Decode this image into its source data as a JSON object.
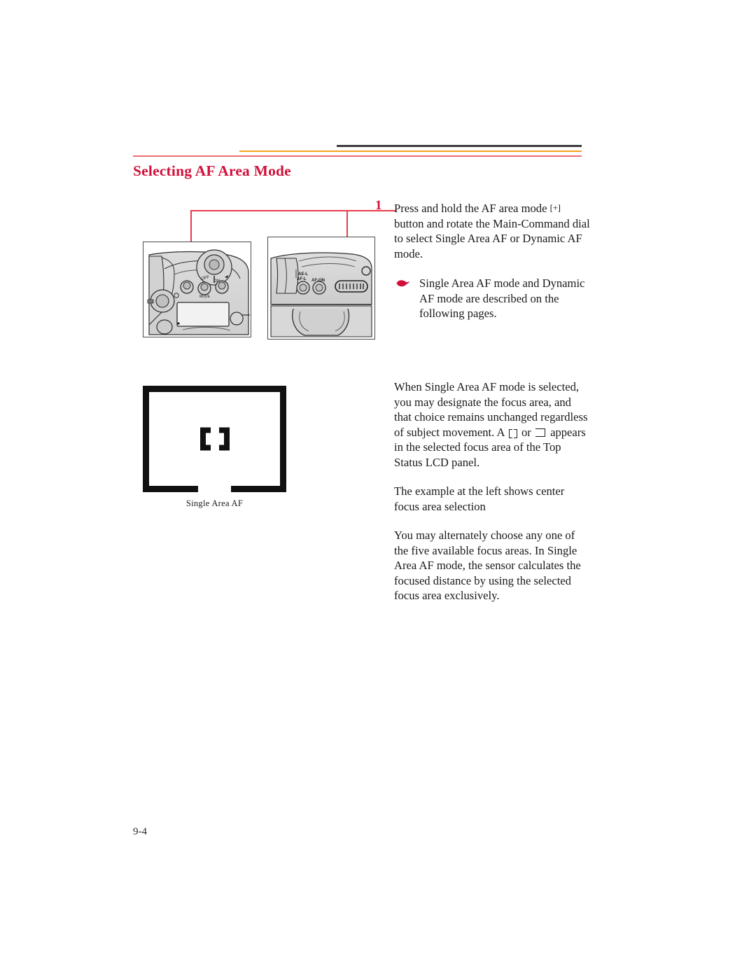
{
  "document": {
    "title": "Selecting AF Area Mode",
    "folio": "9-4"
  },
  "rules": {
    "dark_color": "#3a3a3a",
    "orange_color": "#f5a01e",
    "red_color": "#ea6d72"
  },
  "colors": {
    "title": "#d1103a",
    "step_number": "#d1103a",
    "leader_line": "#ea3b4a",
    "bullet": "#d1103a",
    "body_text": "#1a1a1a"
  },
  "step": {
    "number": "1",
    "text_before_glyph": "Press and hold the AF area mode",
    "button_glyph": "[+]",
    "text_after_glyph": "button and rotate the Main-Command dial to select Single Area AF or Dynamic AF mode."
  },
  "note": {
    "bullet_icon": "pointing-hand-icon",
    "text": "Single Area AF mode and Dynamic AF mode are described on the following pages."
  },
  "body": {
    "paragraph_1_part_1": "When Single Area AF mode is selected, you may designate the focus area, and that choice remains unchanged regardless of subject movement. A",
    "paragraph_1_or": "or",
    "paragraph_1_part_2": "appears in the selected focus area of the Top Status LCD panel.",
    "paragraph_2": "The example at the left shows center focus area selection",
    "paragraph_3": "You may alternately choose any one of the five available focus areas. In Single Area AF mode, the sensor calculates the focused distance by using the selected focus area exclusively."
  },
  "viewfinder": {
    "caption": "Single Area AF",
    "focus_bracket_label": "[ ]"
  },
  "camera_top_view": {
    "label": "camera-top-view-illustration",
    "switch_labels": [
      "OFF",
      "ON"
    ],
    "button_labels": [
      "MODE"
    ]
  },
  "camera_back_view": {
    "label": "camera-back-view-illustration",
    "control_labels": [
      "AE-L",
      "AF-L",
      "AF-ON"
    ],
    "dial_label": "Main-Command dial"
  }
}
